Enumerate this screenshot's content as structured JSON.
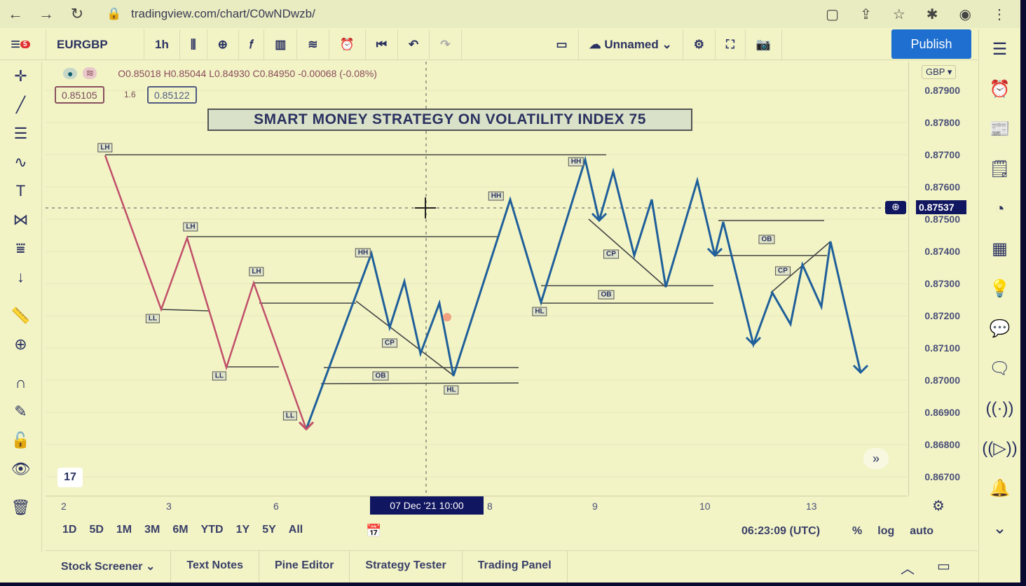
{
  "browser": {
    "url": "tradingview.com/chart/C0wNDwzb/"
  },
  "toolbar": {
    "symbol": "EURGBP",
    "interval": "1h",
    "layout_name": "Unnamed",
    "publish": "Publish",
    "badge": "5"
  },
  "legend": {
    "ohlc": "O0.85018 H0.85044 L0.84930 C0.84950 -0.00068 (-0.08%)",
    "bid": "0.85105",
    "spread": "1.6",
    "ask": "0.85122"
  },
  "chart": {
    "title": "SMART MONEY STRATEGY ON VOLATILITY INDEX 75",
    "currency": "GBP ▾",
    "price_ticks": [
      "0.87900",
      "0.87800",
      "0.87700",
      "0.87600",
      "0.87500",
      "0.87400",
      "0.87300",
      "0.87200",
      "0.87100",
      "0.87000",
      "0.86900",
      "0.86800",
      "0.86700"
    ],
    "current_price": "0.87537",
    "time_ticks": [
      "2",
      "3",
      "6",
      "8",
      "9",
      "10",
      "13"
    ],
    "crosshair_time": "07 Dec '21  10:00",
    "pattern_labels": [
      "LH",
      "LH",
      "LL",
      "LH",
      "LL",
      "LL",
      "HH",
      "CP",
      "OB",
      "HL",
      "HH",
      "HL",
      "HH",
      "CP",
      "OB",
      "OB",
      "CP"
    ],
    "colors": {
      "down_leg": "#c0506a",
      "zigzag": "#1f5f9a",
      "levels": "#444444"
    }
  },
  "ranges": [
    "1D",
    "5D",
    "1M",
    "3M",
    "6M",
    "YTD",
    "1Y",
    "5Y",
    "All"
  ],
  "status": {
    "clock": "06:23:09 (UTC)",
    "percent": "%",
    "log": "log",
    "auto": "auto"
  },
  "bottom_tabs": [
    "Stock Screener ⌄",
    "Text Notes",
    "Pine Editor",
    "Strategy Tester",
    "Trading Panel"
  ]
}
